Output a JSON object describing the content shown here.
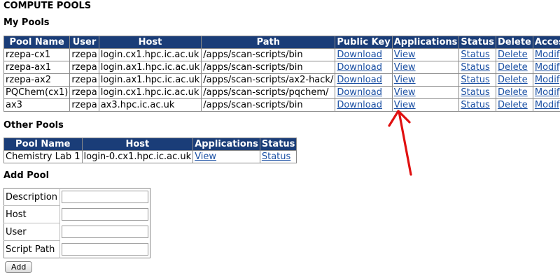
{
  "page_title": "COMPUTE POOLS",
  "my_pools": {
    "title": "My Pools",
    "headers": [
      "Pool Name",
      "User",
      "Host",
      "Path",
      "Public Key",
      "Applications",
      "Status",
      "Delete",
      "Access"
    ],
    "rows": [
      {
        "name": "rzepa-cx1",
        "user": "rzepa",
        "host": "login.cx1.hpc.ic.ac.uk",
        "path": "/apps/scan-scripts/bin",
        "key": "Download",
        "apps": "View",
        "status": "Status",
        "delete": "Delete",
        "access": "Modify"
      },
      {
        "name": "rzepa-ax1",
        "user": "rzepa",
        "host": "login.ax1.hpc.ic.ac.uk",
        "path": "/apps/scan-scripts/bin",
        "key": "Download",
        "apps": "View",
        "status": "Status",
        "delete": "Delete",
        "access": "Modify"
      },
      {
        "name": "rzepa-ax2",
        "user": "rzepa",
        "host": "login.ax1.hpc.ic.ac.uk",
        "path": "/apps/scan-scripts/ax2-hack/",
        "key": "Download",
        "apps": "View",
        "status": "Status",
        "delete": "Delete",
        "access": "Modify"
      },
      {
        "name": "PQChem(cx1)",
        "user": "rzepa",
        "host": "login.cx1.hpc.ic.ac.uk",
        "path": "/apps/scan-scripts/pqchem/",
        "key": "Download",
        "apps": "View",
        "status": "Status",
        "delete": "Delete",
        "access": "Modify"
      },
      {
        "name": "ax3",
        "user": "rzepa",
        "host": "ax3.hpc.ic.ac.uk",
        "path": "/apps/scan-scripts/bin",
        "key": "Download",
        "apps": "View",
        "status": "Status",
        "delete": "Delete",
        "access": "Modify"
      }
    ]
  },
  "other_pools": {
    "title": "Other Pools",
    "headers": [
      "Pool Name",
      "Host",
      "Applications",
      "Status"
    ],
    "rows": [
      {
        "name": "Chemistry Lab 1",
        "host": "login-0.cx1.hpc.ic.ac.uk",
        "apps": "View",
        "status": "Status"
      }
    ]
  },
  "add_pool": {
    "title": "Add Pool",
    "fields": [
      {
        "label": "Description",
        "value": ""
      },
      {
        "label": "Host",
        "value": ""
      },
      {
        "label": "User",
        "value": ""
      },
      {
        "label": "Script Path",
        "value": ""
      }
    ],
    "button": "Add"
  },
  "annotation_arrow": {
    "color": "#e01010",
    "icon": "arrow-up-icon"
  },
  "colors": {
    "header_bg": "#1a3d78",
    "link": "#1a4fa3"
  }
}
